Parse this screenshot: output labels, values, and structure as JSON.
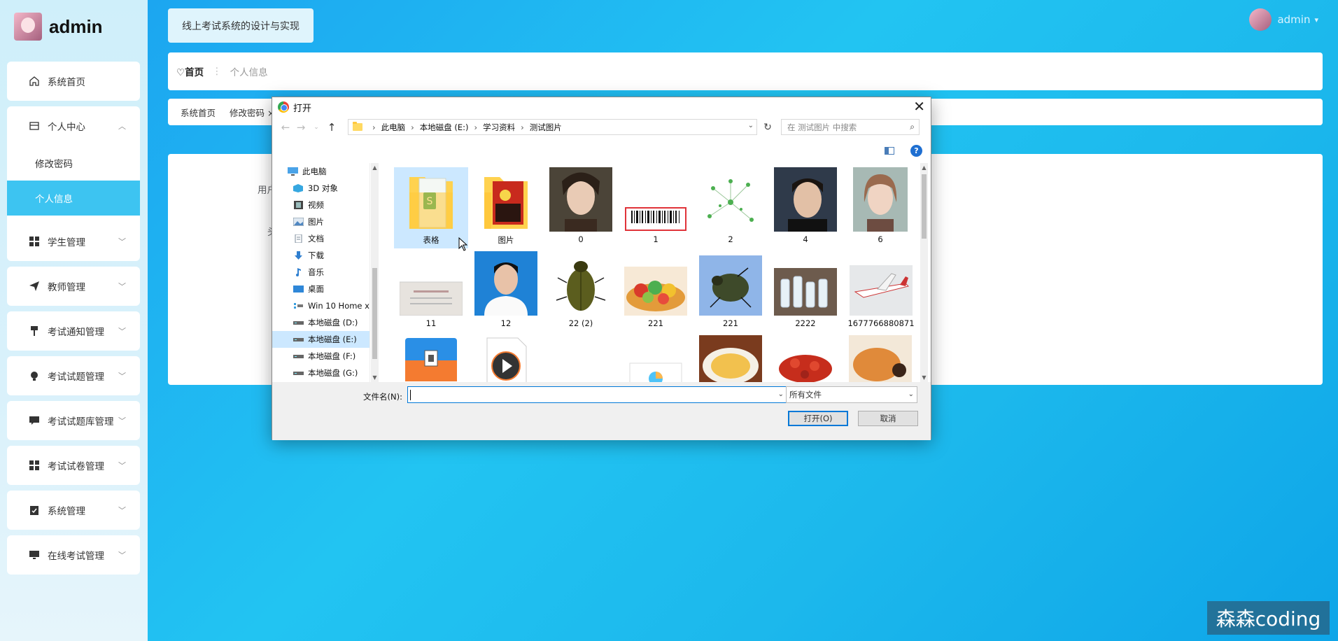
{
  "brand": {
    "title": "admin"
  },
  "sidebar": {
    "home": "系统首页",
    "personal": "个人中心",
    "sub_items": [
      "修改密码",
      "个人信息"
    ],
    "items": [
      "学生管理",
      "教师管理",
      "考试通知管理",
      "考试试题管理",
      "考试试题库管理",
      "考试试卷管理",
      "系统管理",
      "在线考试管理"
    ]
  },
  "user": {
    "name": "admin"
  },
  "header": {
    "system_title": "线上考试系统的设计与实现"
  },
  "breadcrumb": {
    "home": "首页",
    "current": "个人信息"
  },
  "tabs": [
    "系统首页",
    "修改密码 ×"
  ],
  "content": {
    "label1": "用户",
    "label2": "头"
  },
  "dialog": {
    "title": "打开",
    "path": [
      "此电脑",
      "本地磁盘 (E:)",
      "学习资料",
      "测试图片"
    ],
    "search_placeholder": "在 测试图片 中搜索",
    "nav_items": [
      "此电脑",
      "3D 对象",
      "视频",
      "图片",
      "文档",
      "下载",
      "音乐",
      "桌面",
      "Win 10 Home x",
      "本地磁盘 (D:)",
      "本地磁盘 (E:)",
      "本地磁盘 (F:)",
      "本地磁盘 (G:)"
    ],
    "files": [
      "表格",
      "图片",
      "0",
      "1",
      "2",
      "4",
      "6",
      "11",
      "12",
      "22 (2)",
      "221",
      "221",
      "2222",
      "1677766880871"
    ],
    "filename_label": "文件名(N):",
    "filename_value": "",
    "filter_value": "所有文件",
    "open_button": "打开(O)",
    "cancel_button": "取消"
  },
  "watermark": "森森coding"
}
